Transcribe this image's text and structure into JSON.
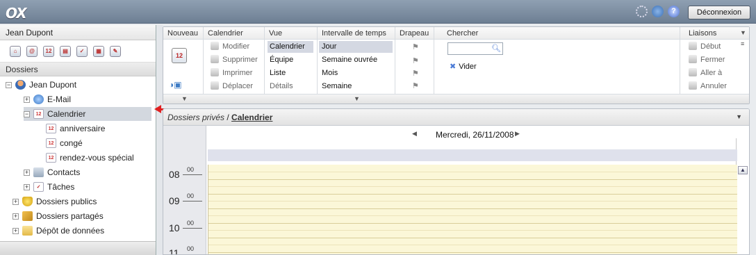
{
  "app": {
    "logo": "OX",
    "logout_label": "Déconnexion"
  },
  "left": {
    "user": "Jean Dupont",
    "folders_label": "Dossiers",
    "module_icons": [
      "home-icon",
      "mail-icon",
      "calendar-icon",
      "contacts-icon",
      "tasks-icon",
      "infostore-icon",
      "settings-icon"
    ],
    "tree": [
      {
        "label": "Jean Dupont",
        "icon": "user-icon",
        "expander": "−"
      },
      {
        "label": "E-Mail",
        "icon": "mail-icon",
        "expander": "+"
      },
      {
        "label": "Calendrier",
        "icon": "calendar-icon",
        "expander": "−",
        "selected": true
      },
      {
        "label": "anniversaire",
        "icon": "calendar-icon"
      },
      {
        "label": "congé",
        "icon": "calendar-icon"
      },
      {
        "label": "rendez-vous spécial",
        "icon": "calendar-icon"
      },
      {
        "label": "Contacts",
        "icon": "contacts-icon",
        "expander": "+"
      },
      {
        "label": "Tâches",
        "icon": "tasks-icon",
        "expander": "+"
      },
      {
        "label": "Dossiers publics",
        "icon": "public-folder-icon",
        "expander": "+"
      },
      {
        "label": "Dossiers partagés",
        "icon": "shared-folder-icon",
        "expander": "+"
      },
      {
        "label": "Dépôt de données",
        "icon": "infostore-folder-icon",
        "expander": "+"
      }
    ]
  },
  "toolbar": {
    "nouveau": {
      "title": "Nouveau"
    },
    "calendrier": {
      "title": "Calendrier",
      "items": [
        "Modifier",
        "Supprimer",
        "Imprimer",
        "Déplacer"
      ]
    },
    "vue": {
      "title": "Vue",
      "items": [
        "Calendrier",
        "Équipe",
        "Liste",
        "Détails"
      ]
    },
    "intervalle": {
      "title": "Intervalle de temps",
      "items": [
        "Jour",
        "Semaine ouvrée",
        "Mois",
        "Semaine"
      ]
    },
    "drapeau": {
      "title": "Drapeau"
    },
    "chercher": {
      "title": "Chercher",
      "search_value": "",
      "vider": "Vider"
    },
    "liaisons": {
      "title": "Liaisons",
      "items": [
        "Début",
        "Fermer",
        "Aller à",
        "Annuler"
      ]
    }
  },
  "calendar": {
    "breadcrumb_prefix": "Dossiers privés",
    "breadcrumb_sep": " / ",
    "breadcrumb_link": "Calendrier",
    "date": "Mercredi, 26/11/2008",
    "hours": [
      {
        "hour": "08",
        "min": "00"
      },
      {
        "hour": "09",
        "min": "00"
      },
      {
        "hour": "10",
        "min": "00"
      },
      {
        "hour": "11",
        "min": "00"
      }
    ]
  },
  "colors": {
    "grid": "#fbf7d8",
    "selection": "#d3d8df",
    "arrow": "#e02020"
  }
}
